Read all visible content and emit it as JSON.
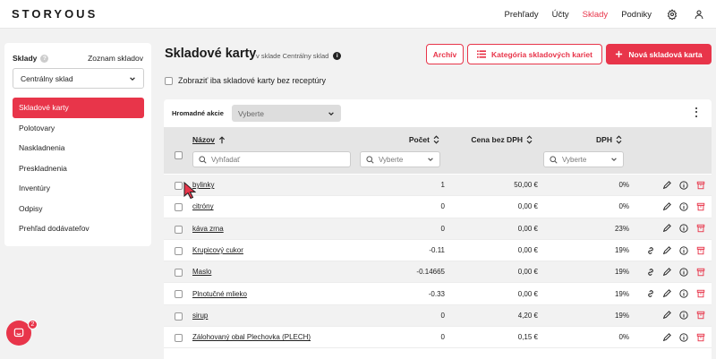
{
  "brand": "STORYOUS",
  "nav": {
    "items": [
      "Prehľady",
      "Účty",
      "Sklady",
      "Podniky"
    ],
    "active": "Sklady",
    "icons": [
      "gear-icon",
      "user-icon"
    ]
  },
  "sidebar": {
    "title": "Sklady",
    "help": "?",
    "list_link": "Zoznam skladov",
    "warehouse_select": "Centrálny sklad",
    "items": [
      {
        "label": "Skladové karty",
        "active": true
      },
      {
        "label": "Polotovary"
      },
      {
        "label": "Naskladnenia"
      },
      {
        "label": "Preskladnenia"
      },
      {
        "label": "Inventúry"
      },
      {
        "label": "Odpisy"
      },
      {
        "label": "Prehľad dodávateľov"
      }
    ]
  },
  "chat": {
    "badge": "2"
  },
  "page": {
    "title": "Skladové karty",
    "subtitle": "v sklade Centrálny sklad",
    "info": "i",
    "buttons": {
      "archiv": "Archív",
      "categories": "Kategória skladových kariet",
      "new": "Nová skladová karta"
    },
    "filter_label": "Zobraziť iba skladové karty bez receptúry"
  },
  "table": {
    "bulk_label": "Hromadné akcie",
    "bulk_placeholder": "Vyberte",
    "columns": {
      "name": "Názov",
      "count": "Počet",
      "price": "Cena bez DPH",
      "dph": "DPH"
    },
    "search_placeholder": "Vyhľadať",
    "select_placeholder": "Vyberte",
    "rows": [
      {
        "name": "bylinky",
        "count": "1",
        "price": "50,00 €",
        "dph": "0%",
        "link": false
      },
      {
        "name": "citróny",
        "count": "0",
        "price": "0,00 €",
        "dph": "0%",
        "link": false
      },
      {
        "name": "káva zrna",
        "count": "0",
        "price": "0,00 €",
        "dph": "23%",
        "link": false
      },
      {
        "name": "Krupicový cukor",
        "count": "-0.11",
        "price": "0,00 €",
        "dph": "19%",
        "link": true
      },
      {
        "name": "Maslo",
        "count": "-0.14665",
        "price": "0,00 €",
        "dph": "19%",
        "link": true
      },
      {
        "name": "Plnotučné mlieko",
        "count": "-0.33",
        "price": "0,00 €",
        "dph": "19%",
        "link": true
      },
      {
        "name": "sirup",
        "count": "0",
        "price": "4,20 €",
        "dph": "19%",
        "link": false
      },
      {
        "name": "Zálohovaný obal Plechovka (PLECH)",
        "count": "0",
        "price": "0,15 €",
        "dph": "0%",
        "link": false
      }
    ]
  },
  "colors": {
    "accent": "#e8354a",
    "header_bg": "#e5e5e5",
    "page_bg": "#f2f2f2"
  }
}
